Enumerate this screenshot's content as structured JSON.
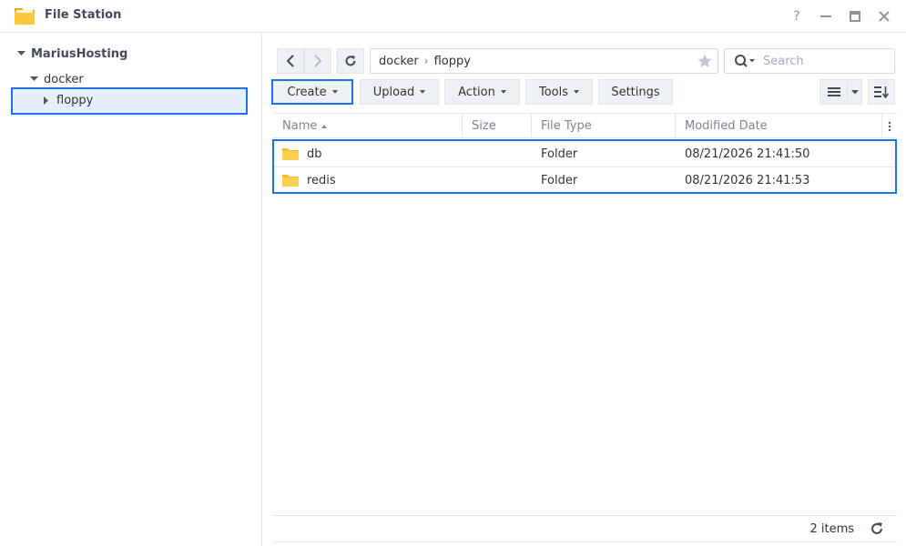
{
  "window": {
    "title": "File Station",
    "controls": [
      "help-icon",
      "minimize-icon",
      "maximize-icon",
      "close-icon"
    ],
    "help_label": "?"
  },
  "sidebar": {
    "items": [
      {
        "label": "MariusHosting",
        "level": 0,
        "expanded": true
      },
      {
        "label": "docker",
        "level": 1,
        "expanded": true
      },
      {
        "label": "floppy",
        "level": 2,
        "expanded": false,
        "selected": true
      }
    ]
  },
  "path": {
    "crumbs": [
      "docker",
      "floppy"
    ],
    "separator": "›"
  },
  "search": {
    "placeholder": "Search"
  },
  "toolbar": {
    "create_label": "Create",
    "upload_label": "Upload",
    "action_label": "Action",
    "tools_label": "Tools",
    "settings_label": "Settings"
  },
  "table": {
    "columns": [
      "Name",
      "Size",
      "File Type",
      "Modified Date"
    ],
    "rows": [
      {
        "name": "db",
        "size": "",
        "type": "Folder",
        "modified": "08/21/2026 21:41:50"
      },
      {
        "name": "redis",
        "size": "",
        "type": "Folder",
        "modified": "08/21/2026 21:41:53"
      }
    ]
  },
  "footer": {
    "count": "2 items"
  },
  "colors": {
    "accent": "#1a73e8",
    "folder": "#f8c33c",
    "selected_bg": "#e6f0fc"
  }
}
